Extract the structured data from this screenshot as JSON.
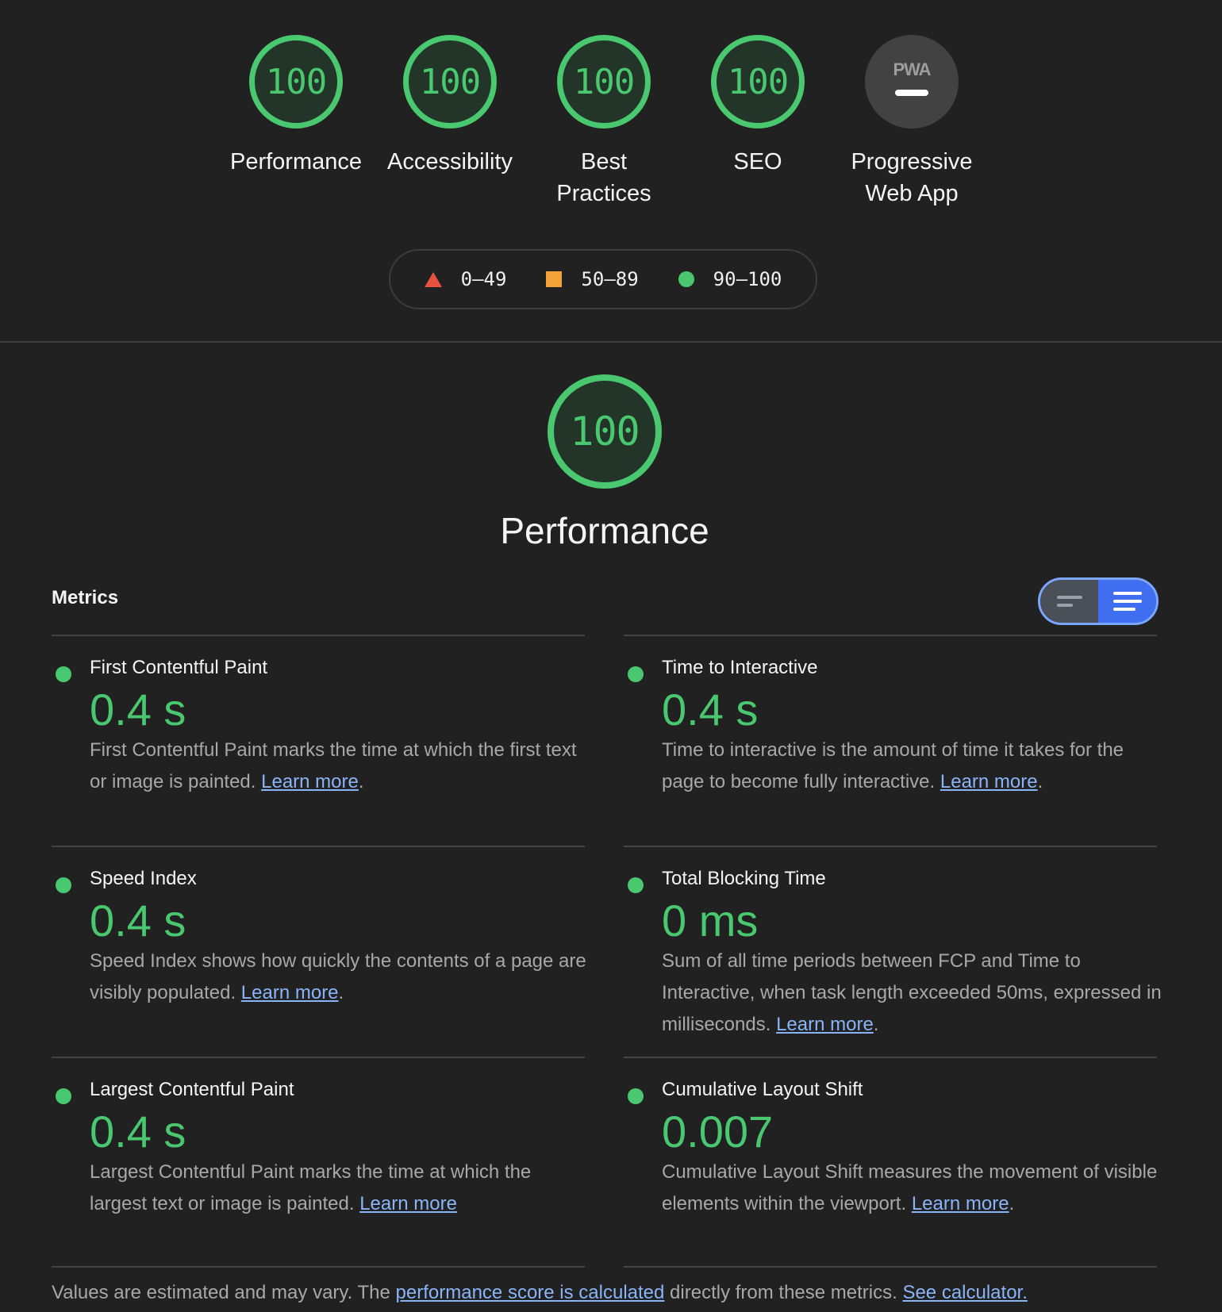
{
  "categories": [
    {
      "score": "100",
      "label": "Performance"
    },
    {
      "score": "100",
      "label": "Accessibility"
    },
    {
      "score": "100",
      "label": "Best\nPractices"
    },
    {
      "score": "100",
      "label": "SEO"
    },
    {
      "badge": "PWA",
      "label": "Progressive\nWeb App"
    }
  ],
  "legend": {
    "fail": "0–49",
    "average": "50–89",
    "pass": "90–100"
  },
  "performance": {
    "score": "100",
    "title": "Performance"
  },
  "metrics": {
    "heading": "Metrics",
    "items": [
      {
        "title": "First Contentful Paint",
        "value": "0.4 s",
        "desc": "First Contentful Paint marks the time at which the first text or image is painted.",
        "link": "Learn more",
        "after": "."
      },
      {
        "title": "Time to Interactive",
        "value": "0.4 s",
        "desc": "Time to interactive is the amount of time it takes for the page to become fully interactive.",
        "link": "Learn more",
        "after": "."
      },
      {
        "title": "Speed Index",
        "value": "0.4 s",
        "desc": "Speed Index shows how quickly the contents of a page are visibly populated.",
        "link": "Learn more",
        "after": "."
      },
      {
        "title": "Total Blocking Time",
        "value": "0 ms",
        "desc": "Sum of all time periods between FCP and Time to Interactive, when task length exceeded 50ms, expressed in milliseconds.",
        "link": "Learn more",
        "after": "."
      },
      {
        "title": "Largest Contentful Paint",
        "value": "0.4 s",
        "desc": "Largest Contentful Paint marks the time at which the largest text or image is painted.",
        "link": "Learn more",
        "after": ""
      },
      {
        "title": "Cumulative Layout Shift",
        "value": "0.007",
        "desc": "Cumulative Layout Shift measures the movement of visible elements within the viewport.",
        "link": "Learn more",
        "after": "."
      }
    ]
  },
  "footer": {
    "prefix": "Values are estimated and may vary. The ",
    "link1": "performance score is calculated",
    "middle": " directly from these metrics. ",
    "link2": "See calculator."
  },
  "colors": {
    "pass": "#4ac870",
    "average": "#f4a33a",
    "fail": "#e8523f",
    "link": "#8ab4f8",
    "toggle_active": "#3f6ff0"
  }
}
